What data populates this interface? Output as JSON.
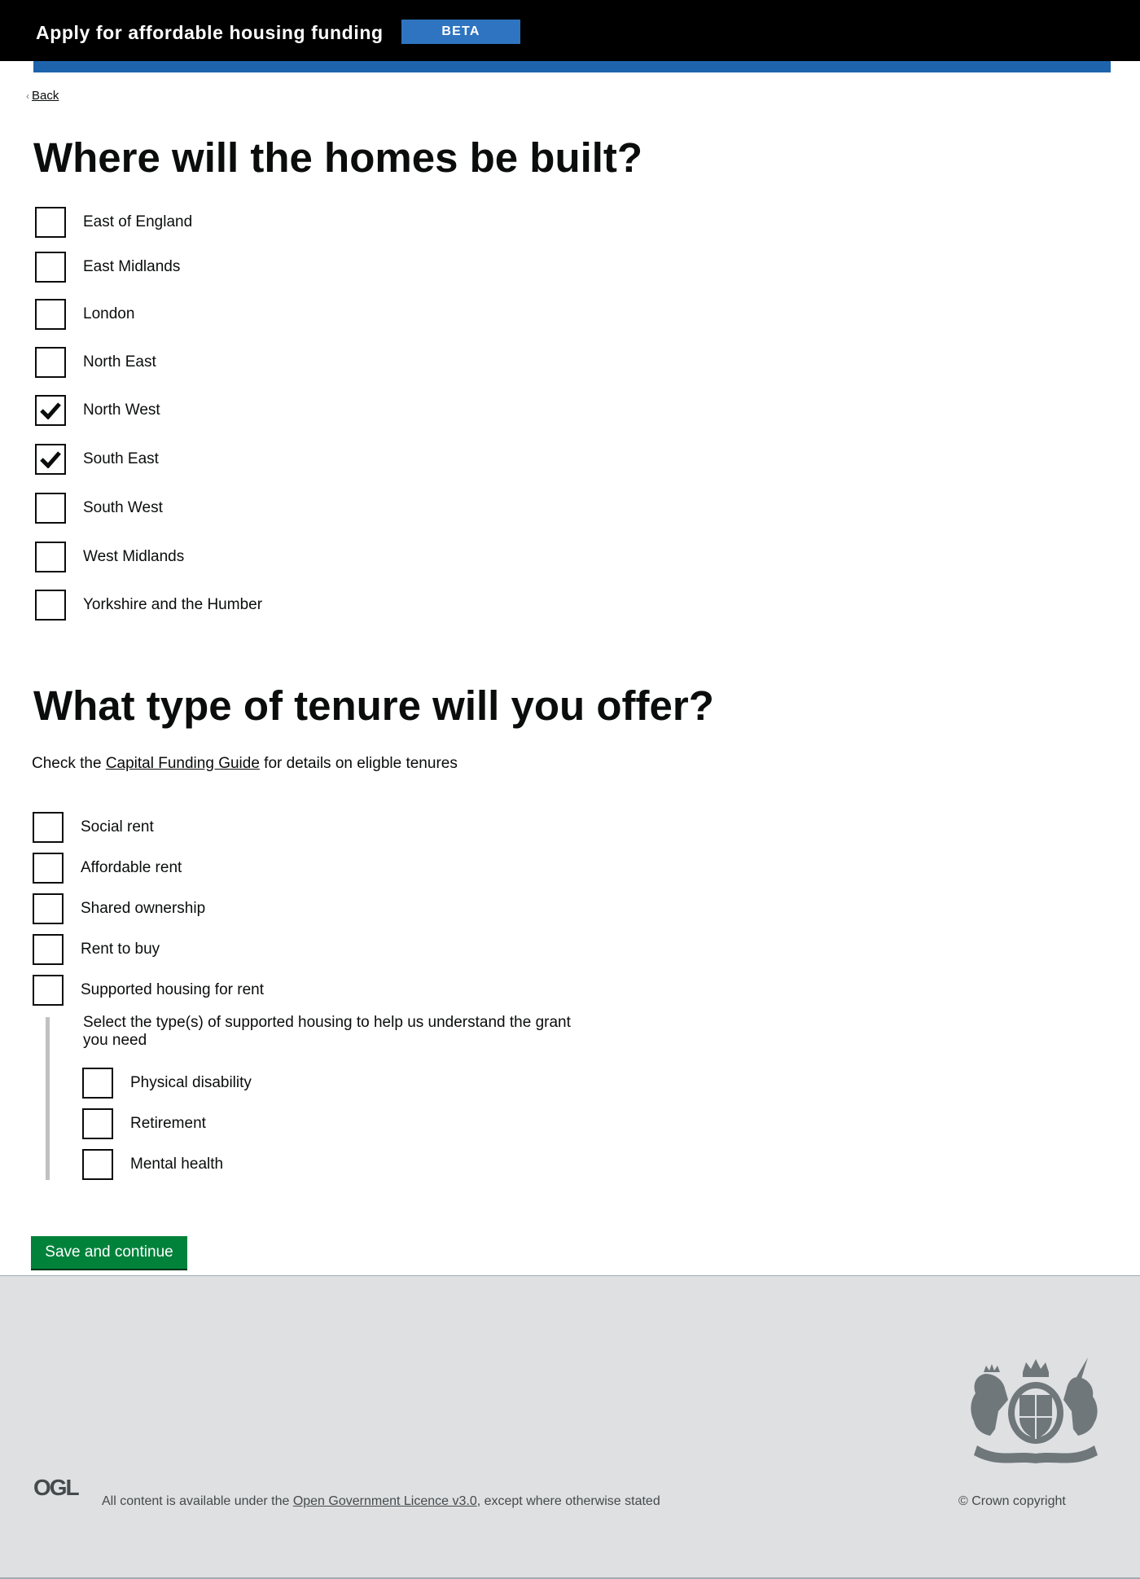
{
  "header": {
    "service_name": "Apply for affordable housing funding",
    "phase_tag": "BETA",
    "background_color": "#000000",
    "tag_color": "#2f74c0",
    "bar_color": "#1d64ad"
  },
  "back_link": {
    "label": "Back"
  },
  "regions_question": {
    "title": "Where will the homes be built?",
    "options": [
      {
        "label": "East of England",
        "checked": false
      },
      {
        "label": "East Midlands",
        "checked": false
      },
      {
        "label": "London",
        "checked": false
      },
      {
        "label": "North East",
        "checked": false
      },
      {
        "label": "North West",
        "checked": true
      },
      {
        "label": "South East",
        "checked": true
      },
      {
        "label": "South West",
        "checked": false
      },
      {
        "label": "West Midlands",
        "checked": false
      },
      {
        "label": "Yorkshire and the Humber",
        "checked": false
      }
    ]
  },
  "tenure_question": {
    "title": "What type of tenure will you offer?",
    "hint_prefix": "Check the ",
    "hint_link": "Capital Funding Guide",
    "hint_suffix": " for details on eligble tenures",
    "options": [
      {
        "label": "Social rent",
        "checked": false
      },
      {
        "label": "Affordable rent",
        "checked": false
      },
      {
        "label": "Shared ownership",
        "checked": false
      },
      {
        "label": "Rent to buy",
        "checked": false
      },
      {
        "label": "Supported housing for rent",
        "checked": false
      }
    ],
    "supported_housing": {
      "hint": "Select the type(s) of supported housing to help us understand the grant you need",
      "options": [
        {
          "label": "Physical disability",
          "checked": false
        },
        {
          "label": "Retirement",
          "checked": false
        },
        {
          "label": "Mental health",
          "checked": false
        }
      ]
    }
  },
  "submit_button": {
    "label": "Save and continue",
    "color": "#00823b"
  },
  "footer": {
    "logo_text": "OGL",
    "licence_prefix": "All content is available under the ",
    "licence_link": "Open Government Licence v3.0",
    "licence_suffix": ", except where otherwise stated",
    "copyright": "© Crown copyright",
    "crest_icon": "royal-coat-of-arms-icon",
    "background_color": "#dee0e2"
  }
}
